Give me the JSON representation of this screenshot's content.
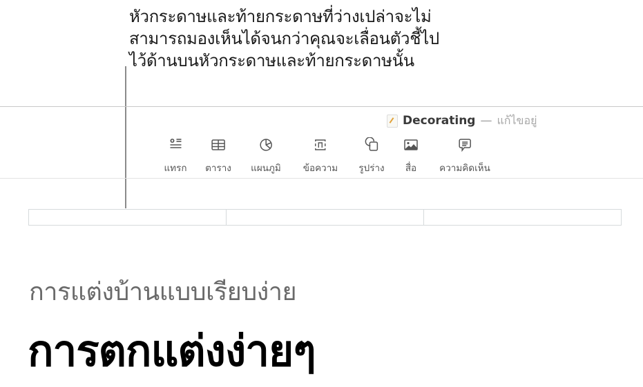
{
  "callout": {
    "lines": [
      "หัวกระดาษและท้ายกระดาษที่ว่างเปล่าจะไม่",
      "สามารถมองเห็นได้จนกว่าคุณจะเลื่อนตัวชี้ไป",
      "ไว้ด้านบนหัวกระดาษและท้ายกระดาษนั้น"
    ]
  },
  "window": {
    "doc_icon": "pages-document-icon",
    "doc_name": "Decorating",
    "separator": "—",
    "status": "แก้ไขอยู่"
  },
  "toolbar": {
    "items": [
      {
        "id": "insert",
        "icon": "insert-icon",
        "label": "แทรก"
      },
      {
        "id": "table",
        "icon": "table-icon",
        "label": "ตาราง"
      },
      {
        "id": "chart",
        "icon": "chart-icon",
        "label": "แผนภูมิ"
      },
      {
        "id": "text",
        "icon": "text-box-icon",
        "label": "ข้อความ"
      },
      {
        "id": "shape",
        "icon": "shape-icon",
        "label": "รูปร่าง"
      },
      {
        "id": "media",
        "icon": "media-icon",
        "label": "สื่อ"
      },
      {
        "id": "comment",
        "icon": "comment-icon",
        "label": "ความคิดเห็น"
      }
    ]
  },
  "document": {
    "header_cells": 3,
    "subtitle": "การแต่งบ้านแบบเรียบง่าย",
    "title": "การตกแต่งง่ายๆ"
  }
}
